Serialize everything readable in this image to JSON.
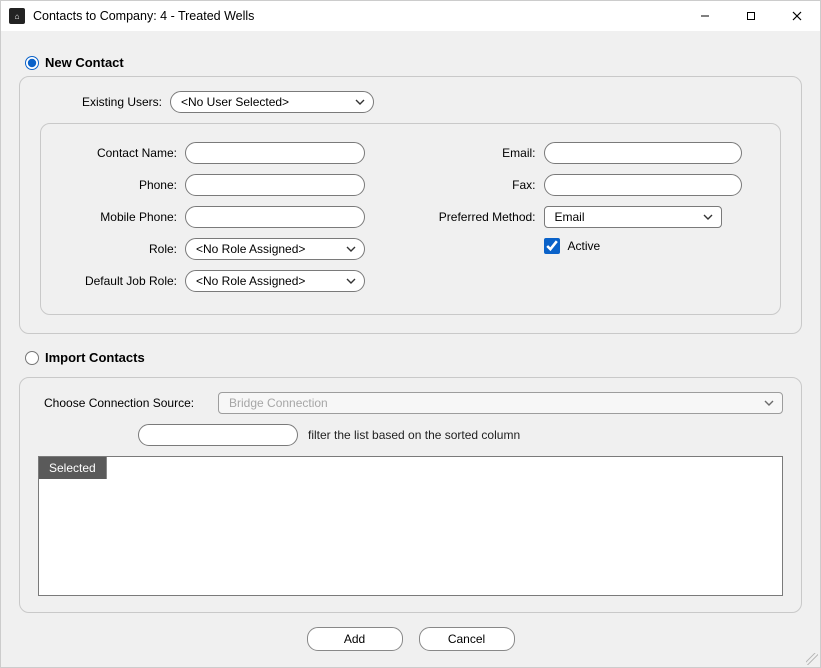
{
  "window": {
    "title": "Contacts to Company: 4 - Treated Wells",
    "app_icon_glyph": "⌂"
  },
  "mode": {
    "new_contact_label": "New Contact",
    "import_contacts_label": "Import Contacts",
    "selected": "new_contact"
  },
  "new_contact": {
    "existing_users_label": "Existing Users:",
    "existing_users_value": "<No User Selected>",
    "fields": {
      "contact_name_label": "Contact Name:",
      "contact_name_value": "",
      "phone_label": "Phone:",
      "phone_value": "",
      "mobile_phone_label": "Mobile Phone:",
      "mobile_phone_value": "",
      "role_label": "Role:",
      "role_value": "<No Role Assigned>",
      "default_job_role_label": "Default Job Role:",
      "default_job_role_value": "<No Role Assigned>",
      "email_label": "Email:",
      "email_value": "",
      "fax_label": "Fax:",
      "fax_value": "",
      "preferred_method_label": "Preferred Method:",
      "preferred_method_value": "Email",
      "active_label": "Active",
      "active_checked": true
    }
  },
  "import": {
    "connection_source_label": "Choose Connection Source:",
    "connection_source_value": "Bridge Connection",
    "filter_value": "",
    "filter_hint": "filter the list based on the sorted column",
    "grid_header": "Selected"
  },
  "buttons": {
    "add": "Add",
    "cancel": "Cancel"
  }
}
